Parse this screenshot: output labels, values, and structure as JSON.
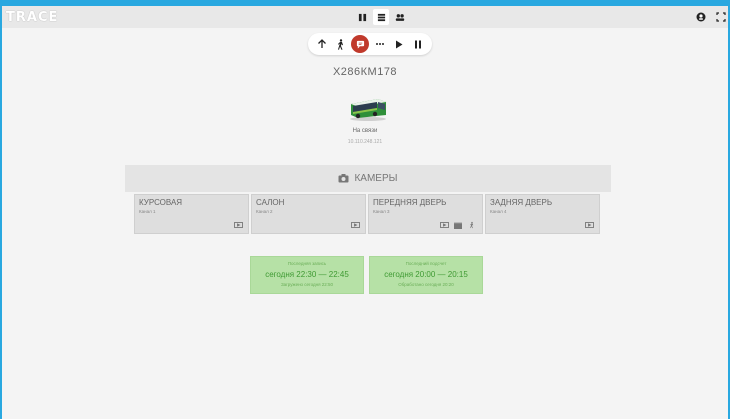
{
  "app": {
    "logo": "TRACE"
  },
  "topbar": {
    "view_icons": [
      "map-icon",
      "list-icon",
      "users-icon"
    ],
    "right_icons": [
      "account-icon",
      "fullscreen-icon"
    ]
  },
  "controls": [
    "arrow-up-icon",
    "walk-icon",
    "message-icon",
    "more-icon",
    "play-icon",
    "pause-icon"
  ],
  "vehicle": {
    "plate": "Х286КМ178",
    "status": "На связи",
    "ip": "10.110.248.121"
  },
  "cameras_section": {
    "title": "КАМЕРЫ"
  },
  "cameras": [
    {
      "name": "КУРСОВАЯ",
      "channel": "Канал 1",
      "icons": [
        "monitor-icon"
      ]
    },
    {
      "name": "САЛОН",
      "channel": "Канал 2",
      "icons": [
        "monitor-icon"
      ]
    },
    {
      "name": "ПЕРЕДНЯЯ ДВЕРЬ",
      "channel": "Канал 3",
      "icons": [
        "monitor-icon",
        "film-icon",
        "walk-icon"
      ]
    },
    {
      "name": "ЗАДНЯЯ ДВЕРЬ",
      "channel": "Канал 4",
      "icons": [
        "monitor-icon"
      ]
    }
  ],
  "records": [
    {
      "label": "Последняя запись",
      "time": "сегодня 22:30 — 22:45",
      "sub": "Загружено сегодня 22:50"
    },
    {
      "label": "Последний подсчет",
      "time": "сегодня 20:00 — 20:15",
      "sub": "Обработано сегодня 20:20"
    }
  ],
  "colors": {
    "accent": "#29a8e0",
    "message": "#c0392b",
    "record_bg": "#b6e1a6"
  }
}
